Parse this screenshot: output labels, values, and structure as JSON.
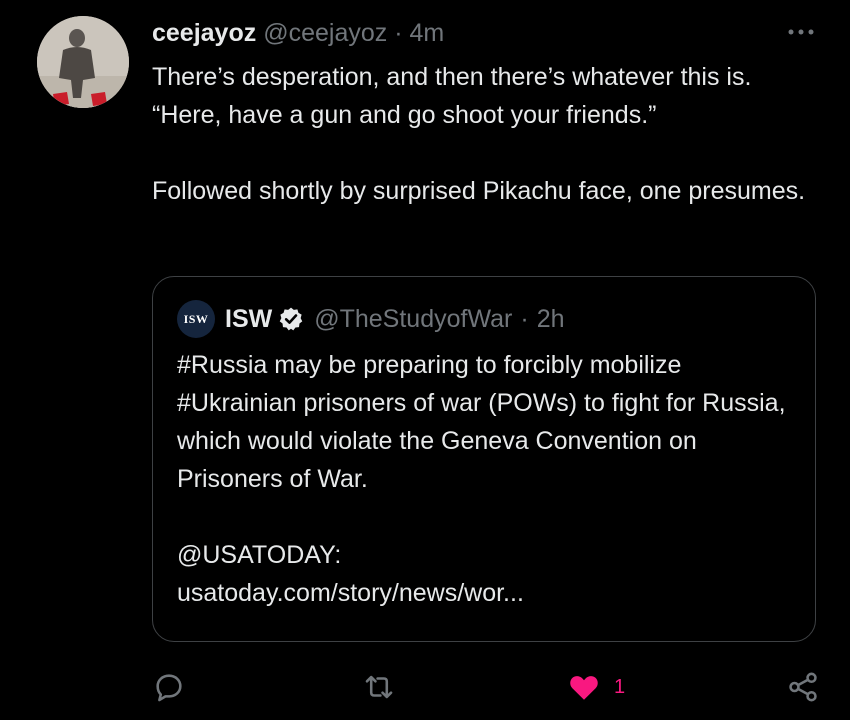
{
  "tweet": {
    "author": {
      "display_name": "ceejayoz",
      "handle": "@ceejayoz"
    },
    "separator": "·",
    "time": "4m",
    "text": "There’s desperation, and then there’s whatever this is. “Here, have a gun and go shoot your friends.”\n\nFollowed shortly by surprised Pikachu face, one presumes."
  },
  "quote": {
    "avatar_label": "ISW",
    "author": {
      "display_name": "ISW",
      "handle": "@TheStudyofWar"
    },
    "separator": "·",
    "time": "2h",
    "text": "#Russia may be preparing to forcibly mobilize #Ukrainian prisoners of war (POWs) to fight for Russia, which would violate the Geneva Convention on Prisoners of War.\n\n@USATODAY:\nusatoday.com/story/news/wor..."
  },
  "actions": {
    "like_count": "1"
  },
  "icons": {
    "more": "more-icon",
    "verified": "verified-icon",
    "reply": "reply-icon",
    "retweet": "retweet-icon",
    "like": "heart-icon",
    "share": "share-icon"
  },
  "colors": {
    "background": "#000000",
    "text": "#e7e9ea",
    "muted": "#71767b",
    "like": "#f91880",
    "border": "#3e4144"
  }
}
